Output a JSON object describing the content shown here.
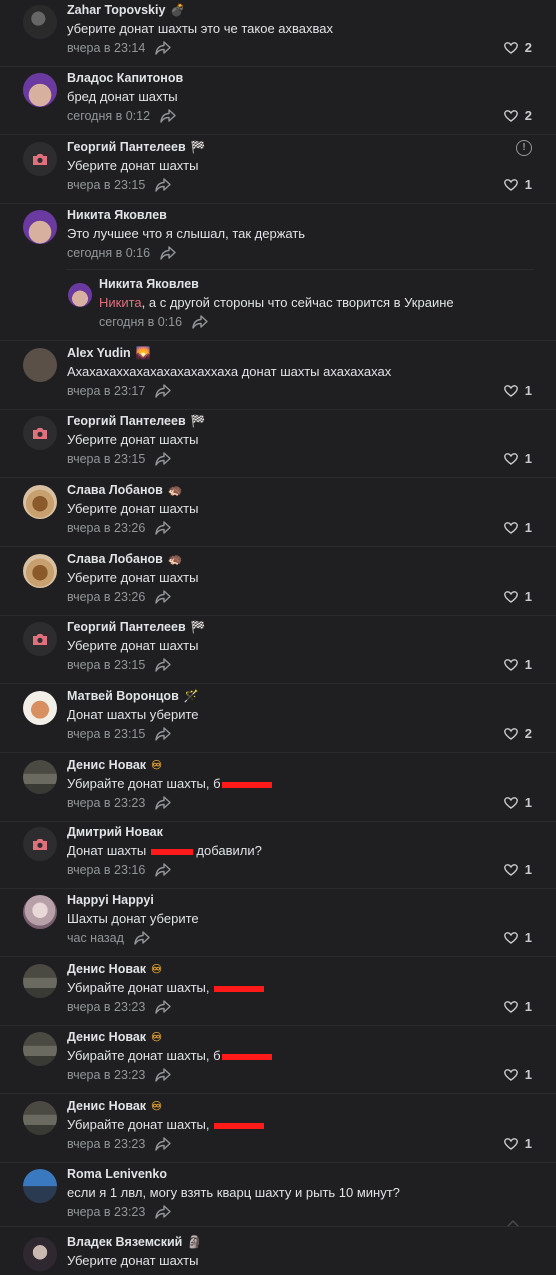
{
  "comments": [
    {
      "author": "Zahar Topovskiy",
      "badge": "💣",
      "text": "уберите донат шахты это че такое ахвахвах",
      "time": "вчера в 23:14",
      "likes": "2"
    },
    {
      "author": "Владос Капитонов",
      "badge": "",
      "text": "бред донат шахты",
      "time": "сегодня в 0:12",
      "likes": "2"
    },
    {
      "author": "Георгий Пантелеев",
      "badge": "🏁",
      "text": "Уберите донат шахты",
      "time": "вчера в 23:15",
      "likes": "1",
      "report": "!"
    },
    {
      "author": "Никита Яковлев",
      "badge": "",
      "text": "Это лучшее что я слышал, так держать",
      "time": "сегодня в 0:16",
      "likes": ""
    },
    {
      "author": "Никита Яковлев",
      "badge": "",
      "mention": "Никита",
      "text": ", а с другой стороны что сейчас творится в Украине",
      "time": "сегодня в 0:16",
      "likes": ""
    },
    {
      "author": "Alex Yudin",
      "badge": "🌄",
      "text": "Ахахахаххахахахахахаххаха донат шахты ахахахахах",
      "time": "вчера в 23:17",
      "likes": "1"
    },
    {
      "author": "Георгий Пантелеев",
      "badge": "🏁",
      "text": "Уберите донат шахты",
      "time": "вчера в 23:15",
      "likes": "1"
    },
    {
      "author": "Слава Лобанов",
      "badge": "🦔",
      "text": "Уберите донат шахты",
      "time": "вчера в 23:26",
      "likes": "1"
    },
    {
      "author": "Слава Лобанов",
      "badge": "🦔",
      "text": "Уберите донат шахты",
      "time": "вчера в 23:26",
      "likes": "1"
    },
    {
      "author": "Георгий Пантелеев",
      "badge": "🏁",
      "text": "Уберите донат шахты",
      "time": "вчера в 23:15",
      "likes": "1"
    },
    {
      "author": "Матвей Воронцов",
      "badge": "🪄",
      "text": "Донат шахты уберите",
      "time": "вчера в 23:15",
      "likes": "2"
    },
    {
      "author": "Денис Новак",
      "badge": "♾",
      "text": "Убирайте донат шахты, б",
      "time": "вчера в 23:23",
      "likes": "1"
    },
    {
      "author": "Дмитрий Новак",
      "badge": "",
      "text": "Донат шахты",
      "text2": " добавили?",
      "time": "вчера в 23:16",
      "likes": "1"
    },
    {
      "author": "Happyi Happyi",
      "badge": "",
      "text": "Шахты донат уберите",
      "time": "час назад",
      "likes": "1"
    },
    {
      "author": "Денис Новак",
      "badge": "♾",
      "text": "Убирайте донат шахты, ",
      "time": "вчера в 23:23",
      "likes": "1"
    },
    {
      "author": "Денис Новак",
      "badge": "♾",
      "text": "Убирайте донат шахты, б",
      "time": "вчера в 23:23",
      "likes": "1"
    },
    {
      "author": "Денис Новак",
      "badge": "♾",
      "text": "Убирайте донат шахты, ",
      "time": "вчера в 23:23",
      "likes": "1"
    },
    {
      "author": "Roma Lenivenko",
      "badge": "",
      "text": "если я 1 лвл, могу взять кварц шахту и рыть 10 минут?",
      "time": "вчера в 23:23",
      "likes": ""
    },
    {
      "author": "Владек Вяземский",
      "badge": "🗿",
      "text": "Уберите донат шахты",
      "time": "",
      "likes": ""
    }
  ],
  "colors": {
    "background": "#1f1f21",
    "mention": "#e0707c",
    "meta": "#939699"
  }
}
